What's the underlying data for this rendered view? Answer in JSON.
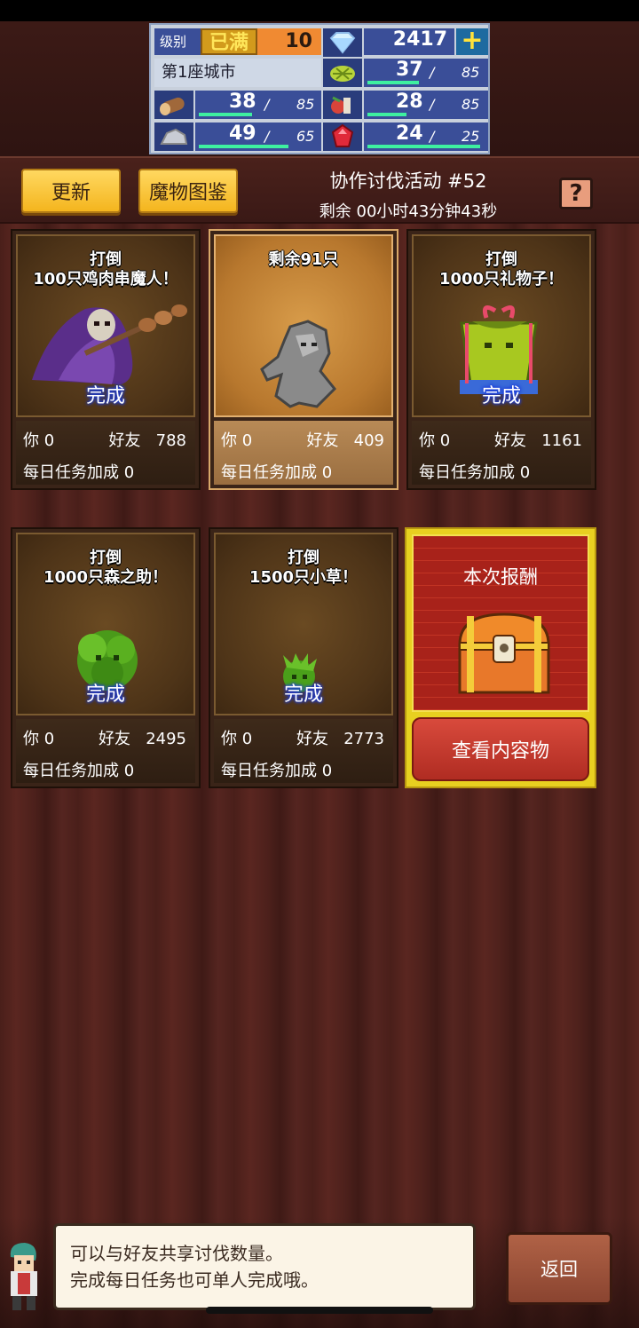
{
  "status": {
    "level_label": "级别",
    "level_badge": "已满",
    "level_value": "10",
    "gems": "2417",
    "city_name": "第1座城市",
    "grass": {
      "value": "37",
      "max": "85",
      "fill": 0.44
    },
    "wood": {
      "value": "38",
      "max": "85",
      "fill": 0.45
    },
    "food": {
      "value": "28",
      "max": "85",
      "fill": 0.33
    },
    "ore": {
      "value": "49",
      "max": "65",
      "fill": 0.75
    },
    "ruby": {
      "value": "24",
      "max": "25",
      "fill": 0.96
    },
    "slash": "/"
  },
  "toolbar": {
    "refresh_label": "更新",
    "monster_book_label": "魔物图鉴",
    "event_title": "协作讨伐活动 #52",
    "event_timer": "剩余 00小时43分钟43秒",
    "help_label": "?"
  },
  "cards": [
    {
      "title1": "打倒",
      "title2": "100只鸡肉串魔人！",
      "done": "完成",
      "you": "你 0",
      "friend_label": "好友",
      "friend": "788",
      "daily": "每日任务加成  0",
      "icon": "reaper-monster-icon"
    },
    {
      "title1": "剩余91只",
      "title2": "",
      "done": "",
      "you": "你 0",
      "friend_label": "好友",
      "friend": "409",
      "daily": "每日任务加成  0",
      "icon": "stone-golem-icon"
    },
    {
      "title1": "打倒",
      "title2": "1000只礼物子！",
      "done": "完成",
      "you": "你 0",
      "friend_label": "好友",
      "friend": "1161",
      "daily": "每日任务加成  0",
      "icon": "gift-monster-icon"
    },
    {
      "title1": "打倒",
      "title2": "1000只森之助！",
      "done": "完成",
      "you": "你 0",
      "friend_label": "好友",
      "friend": "2495",
      "daily": "每日任务加成  0",
      "icon": "bush-monster-icon"
    },
    {
      "title1": "打倒",
      "title2": "1500只小草！",
      "done": "完成",
      "you": "你 0",
      "friend_label": "好友",
      "friend": "2773",
      "daily": "每日任务加成  0",
      "icon": "grass-monster-icon"
    }
  ],
  "reward": {
    "title": "本次报酬",
    "view_label": "查看内容物",
    "icon": "treasure-chest-icon"
  },
  "dialog": {
    "line1": "可以与好友共享讨伐数量。",
    "line2": "完成每日任务也可单人完成哦。"
  },
  "back_label": "返回",
  "colors": {
    "gold_button": "#f4b51e",
    "reward_red": "#a8221a",
    "bar_green": "#3ef0a0"
  }
}
